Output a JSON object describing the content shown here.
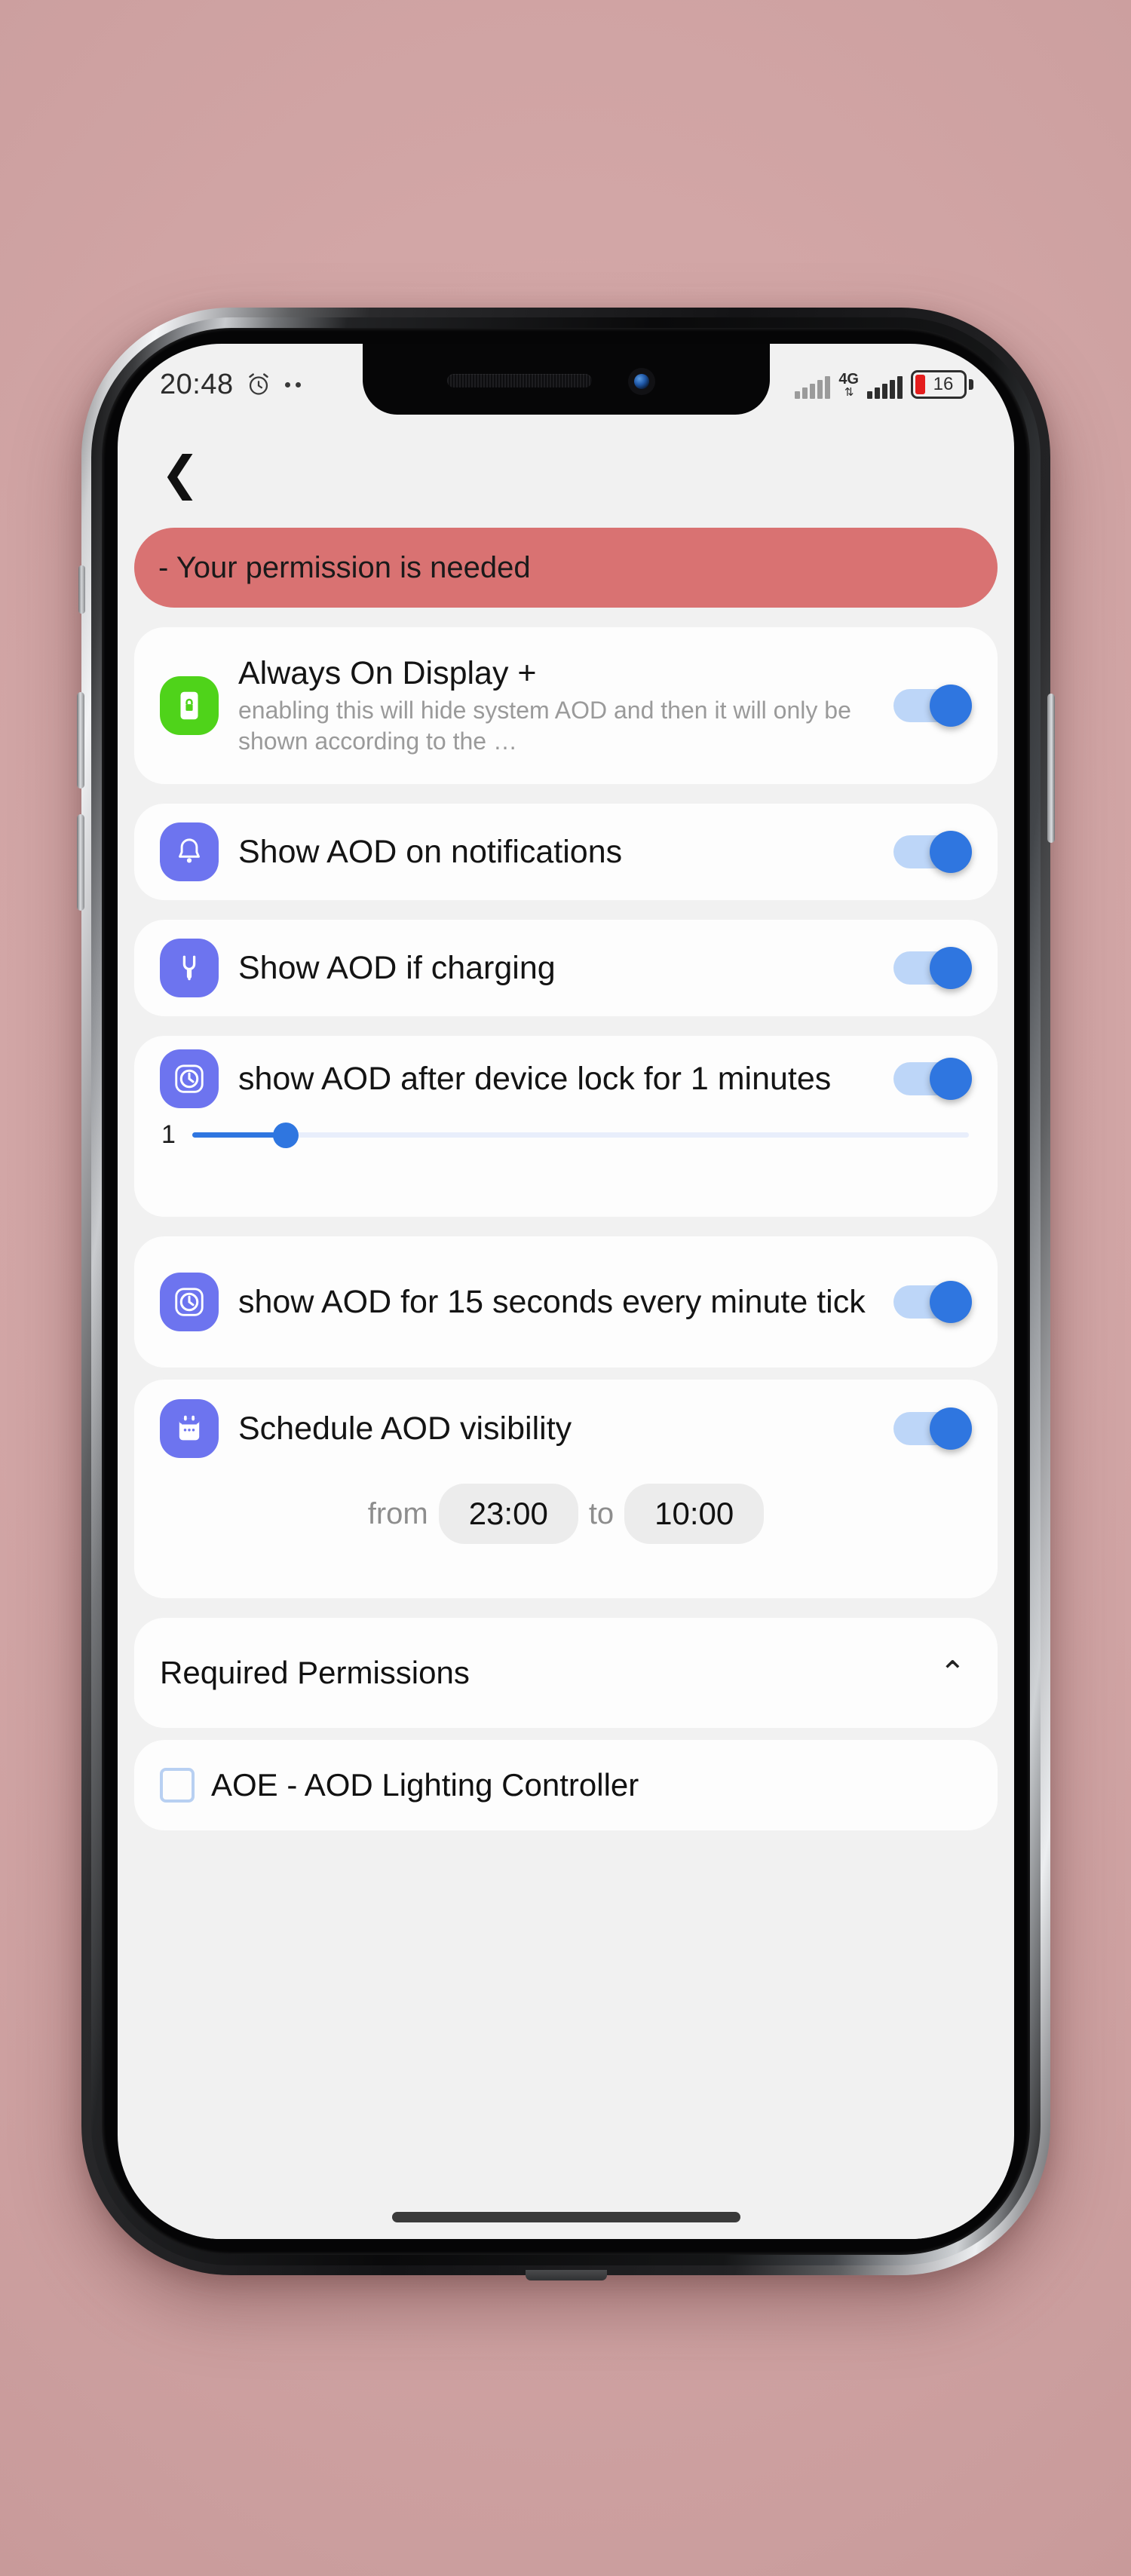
{
  "status_bar": {
    "time": "20:48",
    "alarm_icon": "alarm-clock-icon",
    "network_label": "4G",
    "network_arrows": "⇅",
    "battery_percent": "16"
  },
  "app_bar": {
    "back_label": "❮"
  },
  "banner": {
    "text": "- Your permission is needed"
  },
  "settings": [
    {
      "id": "always-on-display-plus",
      "icon": "phone-lock-icon",
      "icon_color": "#4fd31a",
      "title": "Always On Display +",
      "description": "enabling this will hide system AOD and then it will only be shown according to the …",
      "toggle": "on"
    },
    {
      "id": "show-aod-on-notifications",
      "icon": "bell-icon",
      "icon_color": "#6d74ef",
      "title": "Show AOD on notifications",
      "toggle": "on"
    },
    {
      "id": "show-aod-if-charging",
      "icon": "power-plug-icon",
      "icon_color": "#6d74ef",
      "title": "Show AOD if charging",
      "toggle": "on"
    },
    {
      "id": "show-aod-after-device-lock",
      "icon": "clock-icon",
      "icon_color": "#6d74ef",
      "title": "show AOD after device lock for 1 minutes",
      "toggle": "on",
      "slider_value": "1"
    },
    {
      "id": "show-aod-every-minute-tick",
      "icon": "clock-icon",
      "icon_color": "#6d74ef",
      "title": "show AOD for 15 seconds every minute tick",
      "toggle": "on"
    },
    {
      "id": "schedule-aod-visibility",
      "icon": "calendar-icon",
      "icon_color": "#6d74ef",
      "title": "Schedule AOD visibility",
      "toggle": "on",
      "from_label": "from",
      "from_time": "23:00",
      "to_label": "to",
      "to_time": "10:00"
    }
  ],
  "permissions": {
    "header": "Required Permissions",
    "collapse_icon": "⌃",
    "items": [
      {
        "label": "AOE - AOD Lighting Controller",
        "checked": false
      }
    ]
  },
  "colors": {
    "accent_blue": "#2f76e0",
    "toggle_track": "#bdd6f8",
    "banner_red": "#d97272",
    "icon_green": "#4fd31a",
    "icon_indigo": "#6d74ef",
    "background": "#d3a7a7"
  }
}
